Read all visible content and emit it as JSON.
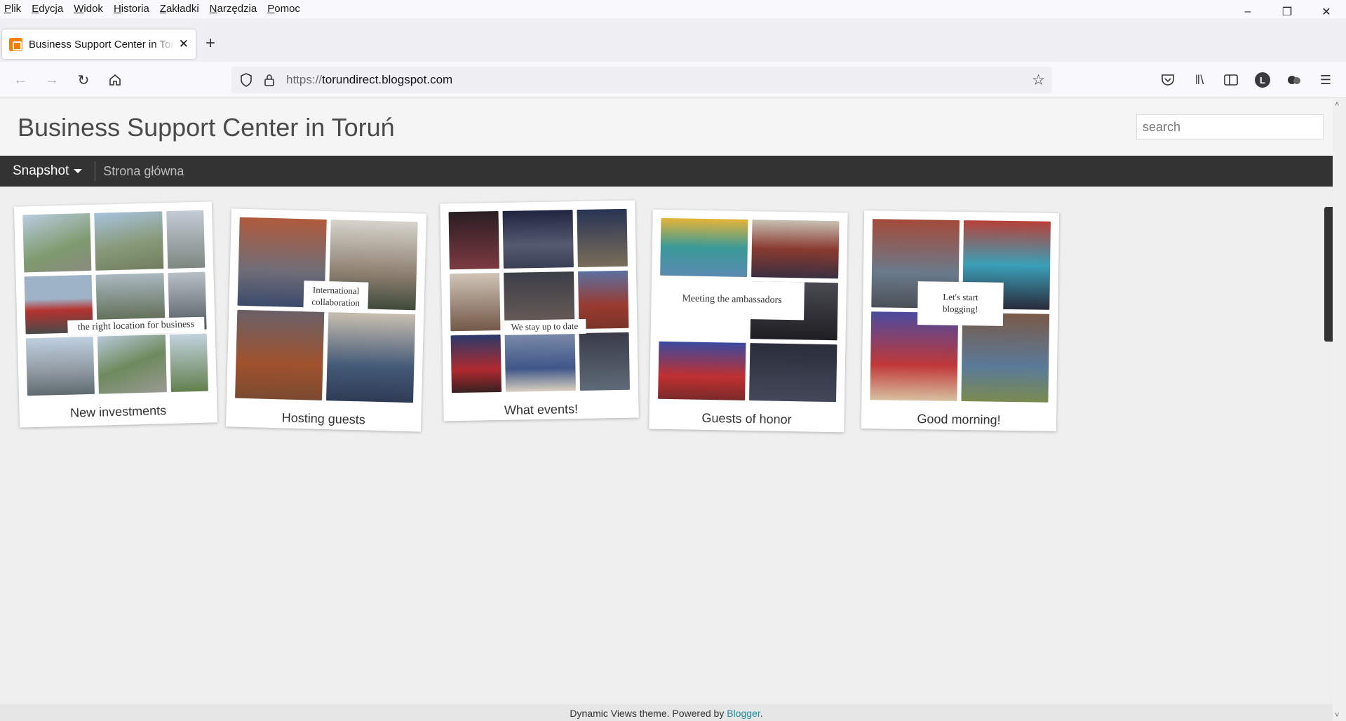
{
  "menubar": {
    "items": [
      {
        "first": "P",
        "rest": "lik"
      },
      {
        "first": "E",
        "rest": "dycja"
      },
      {
        "first": "W",
        "rest": "idok"
      },
      {
        "first": "H",
        "rest": "istoria"
      },
      {
        "first": "Z",
        "rest": "akładki"
      },
      {
        "first": "N",
        "rest": "arzędzia"
      },
      {
        "first": "P",
        "rest": "omoc"
      }
    ]
  },
  "tab": {
    "title": "Business Support Center in Toruń"
  },
  "urlbar": {
    "scheme": "https://",
    "host": "torundirect.blogspot.com"
  },
  "blog": {
    "title": "Business Support Center in Toruń",
    "search_placeholder": "search"
  },
  "viewbar": {
    "view": "Snapshot",
    "home": "Strona główna"
  },
  "cards": [
    {
      "caption": "New investments",
      "overlay": "the right location for business"
    },
    {
      "caption": "Hosting guests",
      "overlay": "International collaboration"
    },
    {
      "caption": "What events!",
      "overlay": "We stay up to date"
    },
    {
      "caption": "Guests of honor",
      "overlay": "Meeting the ambassadors"
    },
    {
      "caption": "Good morning!",
      "overlay": "Let's start blogging!"
    }
  ],
  "footer": {
    "text": "Dynamic Views theme. Powered by ",
    "link": "Blogger",
    "suffix": "."
  }
}
